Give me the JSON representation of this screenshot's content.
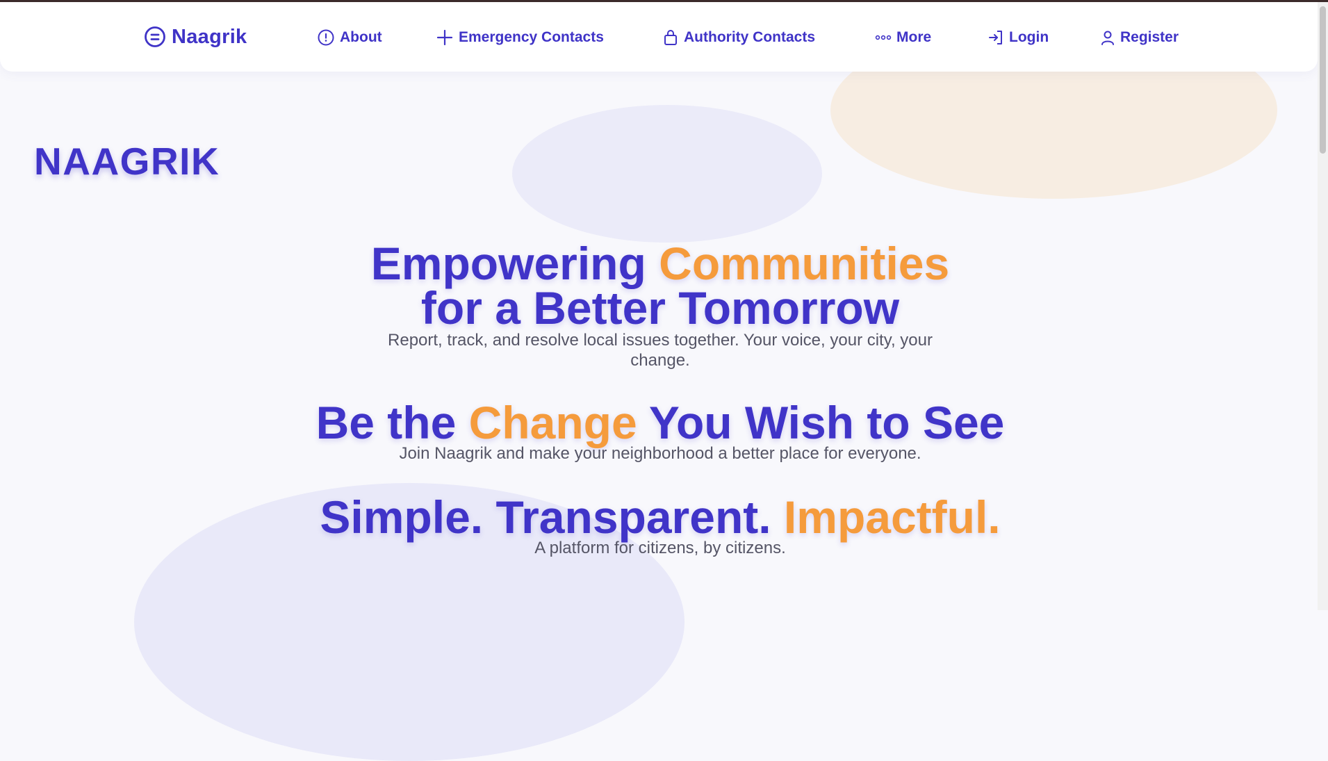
{
  "colors": {
    "primary": "#4034c8",
    "accent": "#f59b3c",
    "text_muted": "#555566",
    "background": "#f8f8fc"
  },
  "nav": {
    "brand": {
      "label": "Naagrik",
      "icon": "logo-circle-icon"
    },
    "items": [
      {
        "label": "About",
        "icon": "info-icon"
      },
      {
        "label": "Emergency Contacts",
        "icon": "plus-icon"
      },
      {
        "label": "Authority Contacts",
        "icon": "lock-icon"
      },
      {
        "label": "More",
        "icon": "dots-icon"
      },
      {
        "label": "Login",
        "icon": "login-icon"
      },
      {
        "label": "Register",
        "icon": "user-icon"
      }
    ]
  },
  "page_title": "NAAGRIK",
  "hero": {
    "headline": {
      "part1": "Empowering ",
      "accent": "Communities",
      "part2": " for a Better Tomorrow"
    },
    "subtitle": "Report, track, and resolve local issues together. Your voice, your city, your change."
  },
  "section2": {
    "headline": {
      "part1": "Be the ",
      "accent": "Change",
      "part2": " You Wish to See"
    },
    "subtitle": "Join Naagrik and make your neighborhood a better place for everyone."
  },
  "section3": {
    "headline": {
      "part1": "Simple. Transparent. ",
      "accent": "Impactful."
    },
    "subtitle": "A platform for citizens, by citizens."
  }
}
